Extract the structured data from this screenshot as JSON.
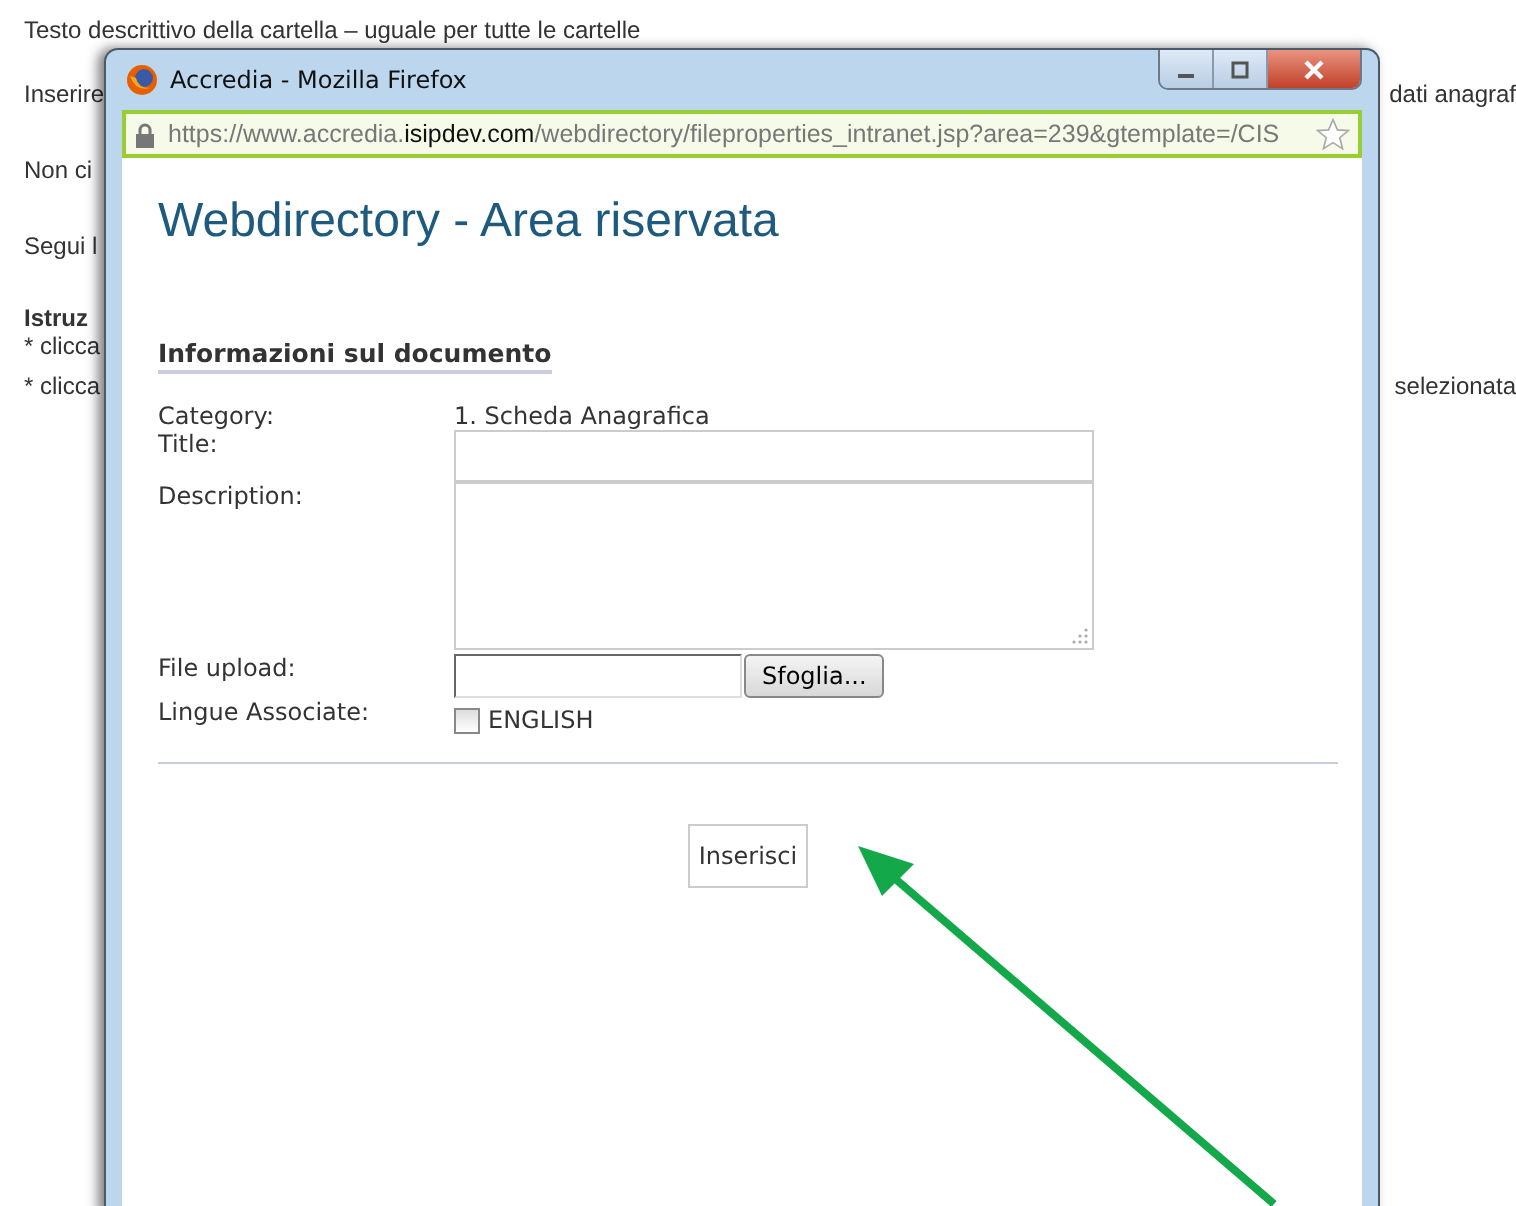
{
  "background_page": {
    "lines": [
      {
        "kind": "text",
        "left": "Testo descrittivo della cartella – uguale per tutte le cartelle"
      },
      {
        "kind": "text",
        "left": "Inserire",
        "right": "dati anagraf"
      },
      {
        "kind": "text",
        "left": "Non ci"
      },
      {
        "kind": "text",
        "left": "Segui l"
      },
      {
        "kind": "heading",
        "left": "Istruz"
      },
      {
        "kind": "text",
        "left": "* clicca"
      },
      {
        "kind": "text",
        "left": "* clicca",
        "right": "selezionata"
      }
    ]
  },
  "window": {
    "title": "Accredia - Mozilla Firefox",
    "url": "https://www.accredia.**isipdev.com**/webdirectory/fileproperties_intranet.jsp?area=239&gtemplate=/CIS"
  },
  "page": {
    "heading": "Webdirectory - Area riservata",
    "section": "Informazioni sul documento",
    "fields": [
      {
        "kind": "text",
        "label": "Category:",
        "value": "1. Scheda Anagrafica"
      },
      {
        "kind": "input",
        "label": "Title:"
      },
      {
        "kind": "textarea",
        "label": "Description:"
      },
      {
        "kind": "file",
        "label": "File upload:",
        "button": "Sfoglia..."
      },
      {
        "kind": "checkbox",
        "label": "Lingue Associate:",
        "option": "ENGLISH",
        "checked": false
      }
    ],
    "submit": "Inserisci"
  }
}
